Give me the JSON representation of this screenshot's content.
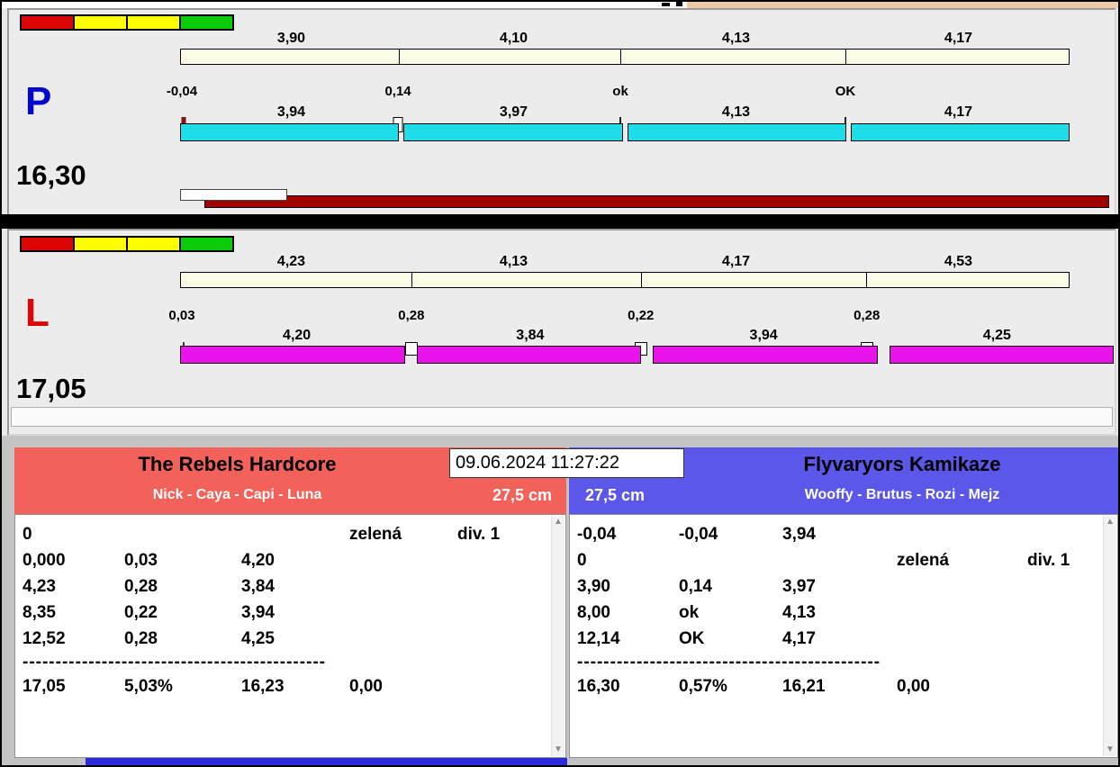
{
  "titlebar": {
    "left_color": "#ffffff",
    "right_color": "#ecc9a4"
  },
  "lights": {
    "colors": [
      "#dd0404",
      "#ffff04",
      "#ffff04",
      "#0acc0a"
    ]
  },
  "panel_p": {
    "letter": "P",
    "letter_color": "#0008cc",
    "total": "16,30",
    "top_values": [
      "3,90",
      "4,10",
      "4,13",
      "4,17"
    ],
    "marker_labels": [
      "-0,04",
      "0,14",
      "ok",
      "OK"
    ],
    "bottom_values": [
      "3,94",
      "3,97",
      "4,13",
      "4,17"
    ],
    "bar_color": "#1edce8",
    "progress_color": "#a00000"
  },
  "panel_l": {
    "letter": "L",
    "letter_color": "#e00404",
    "total": "17,05",
    "top_values": [
      "4,23",
      "4,13",
      "4,17",
      "4,53"
    ],
    "marker_labels": [
      "0,03",
      "0,28",
      "0,22",
      "0,28"
    ],
    "bottom_values": [
      "4,20",
      "3,84",
      "3,94",
      "4,25"
    ],
    "bar_color": "#ea14ea"
  },
  "clock": {
    "datetime": "09.06.2024 11:27:22"
  },
  "team_left": {
    "name": "The Rebels Hardcore",
    "members": "Nick - Caya - Capi - Luna",
    "jump_height": "27,5 cm",
    "header_color": "#f2615a",
    "rows": [
      [
        "0",
        "",
        "",
        "zelená",
        "div. 1"
      ],
      [
        "0,000",
        "0,03",
        "4,20",
        "",
        ""
      ],
      [
        "4,23",
        "0,28",
        "3,84",
        "",
        ""
      ],
      [
        "8,35",
        "0,22",
        "3,94",
        "",
        ""
      ],
      [
        "12,52",
        "0,28",
        "4,25",
        "",
        ""
      ]
    ],
    "divider": "----------------------------------------------",
    "summary": [
      "17,05",
      "5,03%",
      "16,23",
      "0,00"
    ]
  },
  "team_right": {
    "name": "Flyvaryors Kamikaze",
    "members": "Wooffy - Brutus - Rozi - Mejz",
    "jump_height": "27,5 cm",
    "header_color": "#5b57e8",
    "rows": [
      [
        "-0,04",
        "-0,04",
        "3,94",
        "",
        ""
      ],
      [
        "0",
        "",
        "",
        "zelená",
        "div. 1"
      ],
      [
        "3,90",
        "0,14",
        "3,97",
        "",
        ""
      ],
      [
        "8,00",
        "ok",
        "4,13",
        "",
        ""
      ],
      [
        "12,14",
        "OK",
        "4,17",
        "",
        ""
      ]
    ],
    "divider": "----------------------------------------------",
    "summary": [
      "16,30",
      "0,57%",
      "16,21",
      "0,00"
    ]
  }
}
